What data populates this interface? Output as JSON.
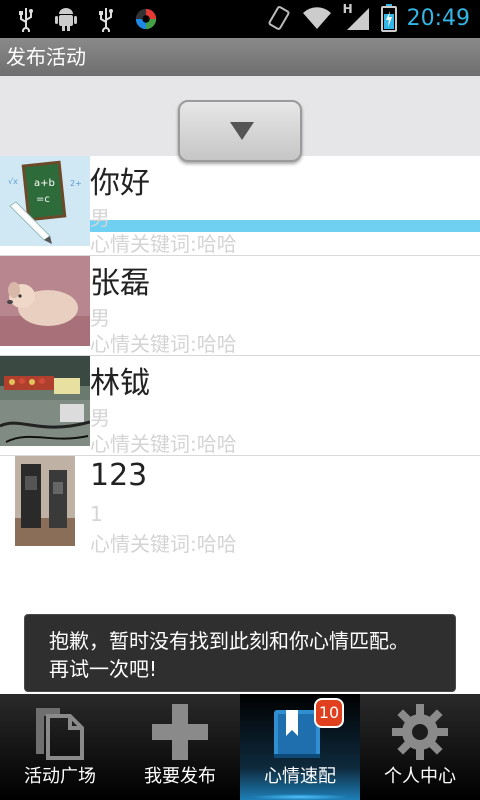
{
  "status_bar": {
    "time": "20:49",
    "left_icons": [
      "usb-icon",
      "android-debug-icon",
      "usb-icon",
      "app-notification-icon"
    ],
    "right_icons": [
      "rotate-icon",
      "wifi-icon",
      "signal-icon",
      "battery-charging-icon"
    ],
    "network_label": "H"
  },
  "app_bar": {
    "title": "发布活动"
  },
  "pull_refresh": {
    "icon": "arrow-down-icon"
  },
  "list": {
    "items": [
      {
        "name": "你好",
        "gender": "男",
        "keywords": "心情关键词:哈哈",
        "avatar": "chalkboard-avatar"
      },
      {
        "name": "张磊",
        "gender": "男",
        "keywords": "心情关键词:哈哈",
        "avatar": "dog-avatar"
      },
      {
        "name": "林钺",
        "gender": "男",
        "keywords": "心情关键词:哈哈",
        "avatar": "desk-photo-avatar"
      },
      {
        "name": "123",
        "gender": "1",
        "keywords": "心情关键词:哈哈",
        "avatar": "devices-photo-avatar"
      }
    ]
  },
  "toast": {
    "line1": "抱歉，暂时没有找到此刻和你心情匹配。",
    "line2": "再试一次吧!"
  },
  "bottom_nav": {
    "items": [
      {
        "label": "活动广场",
        "icon": "documents-icon"
      },
      {
        "label": "我要发布",
        "icon": "plus-icon"
      },
      {
        "label": "心情速配",
        "icon": "bookmark-book-icon",
        "badge": "10",
        "active": true
      },
      {
        "label": "个人中心",
        "icon": "gear-icon"
      }
    ]
  },
  "colors": {
    "accent": "#33b5e5",
    "pull_line": "#6fd0f2",
    "badge": "#e0401e",
    "secondary_text": "#d4d4d4"
  }
}
